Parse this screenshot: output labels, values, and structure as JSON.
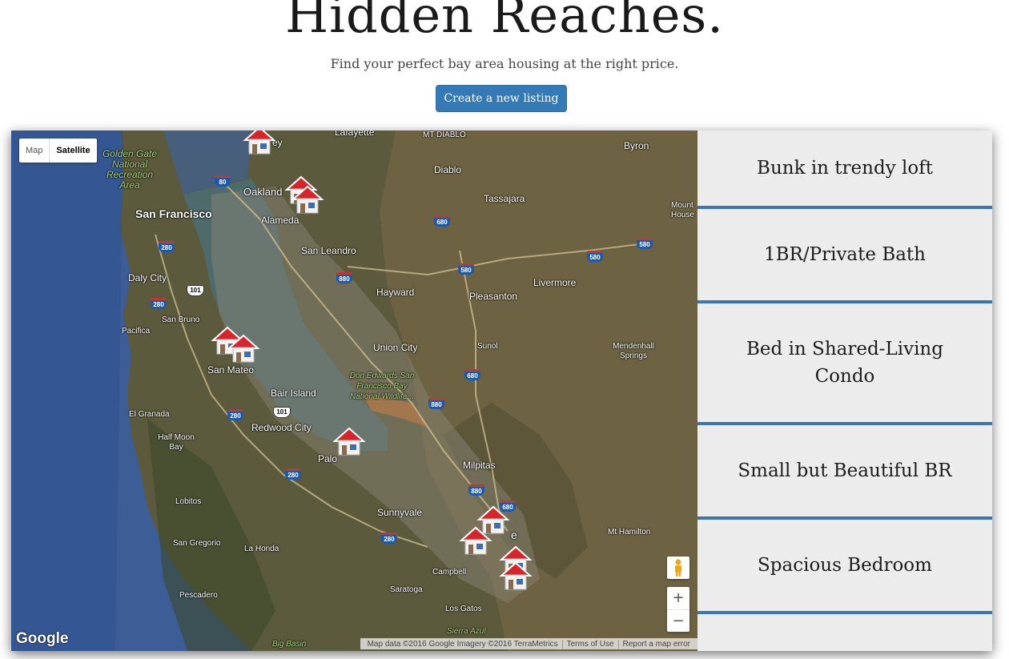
{
  "header": {
    "title": "Hidden Reaches.",
    "subtitle": "Find your perfect bay area housing at the right price.",
    "create_button": "Create a new listing"
  },
  "map": {
    "type_control": {
      "map": "Map",
      "satellite": "Satellite",
      "selected": "Satellite"
    },
    "labels": {
      "lafayette": "Lafayette",
      "berkeley": "ey",
      "mt_diablo": "MT DIABLO",
      "byron": "Byron",
      "golden_gate": "Golden Gate National Recreation Area",
      "oakland": "Oakland",
      "diablo": "Diablo",
      "tassajara": "Tassajara",
      "san_francisco": "San Francisco",
      "alameda": "Alameda",
      "mount_house": "Mount House",
      "san_leandro": "San Leandro",
      "daly_city": "Daly City",
      "hayward": "Hayward",
      "livermore": "Livermore",
      "pleasanton": "Pleasanton",
      "san_bruno": "San Bruno",
      "pacifica": "Pacifica",
      "union_city": "Union City",
      "sunol": "Sunol",
      "mendenhall": "Mendenhall Springs",
      "san_mateo": "San Mateo",
      "don_edwards": "Don Edwards San Francisco Bay National Wildlife...",
      "bair_island": "Bair Island",
      "el_granada": "El Granada",
      "redwood_city": "Redwood City",
      "half_moon_bay": "Half Moon Bay",
      "palo_alto": "Palo",
      "milpitas": "Milpitas",
      "lobitos": "Lobitos",
      "sunnyvale": "Sunnyvale",
      "san_jose": "e",
      "mt_hamilton": "Mt Hamilton",
      "san_gregorio": "San Gregorio",
      "la_honda": "La Honda",
      "campbell": "Campbell",
      "pescadero": "Pescadero",
      "saratoga": "Saratoga",
      "los_gatos": "Los Gatos",
      "sierra_azul": "Sierra Azul",
      "big_basin": "Big Basin"
    },
    "shields": {
      "i80": "80",
      "i680a": "680",
      "i580a": "580",
      "i580b": "580",
      "i580c": "580",
      "i280a": "280",
      "i880a": "880",
      "us101a": "101",
      "i280b": "280",
      "i680b": "680",
      "i880b": "880",
      "i280c": "280",
      "us101b": "101",
      "i280d": "280",
      "i880c": "880",
      "i680c": "680",
      "i280e": "280"
    },
    "google": "Google",
    "attribution": {
      "data": "Map data ©2016 Google Imagery ©2016 TerraMetrics",
      "terms": "Terms of Use",
      "report": "Report a map error"
    },
    "zoom_in": "+",
    "zoom_out": "−",
    "marker_icon": "house-marker-icon",
    "pegman_icon": "pegman-icon"
  },
  "listings": [
    {
      "title": "Bunk in trendy loft"
    },
    {
      "title": "1BR/Private Bath"
    },
    {
      "title": "Bed in Shared-Living Condo"
    },
    {
      "title": "Small but Beautiful BR"
    },
    {
      "title": "Spacious Bedroom"
    }
  ],
  "colors": {
    "accent": "#337ab7",
    "listing_rule": "#3a76b0",
    "listing_bg": "#ececec",
    "ocean": "#3f5f9a",
    "marker_roof": "#d7262b"
  }
}
